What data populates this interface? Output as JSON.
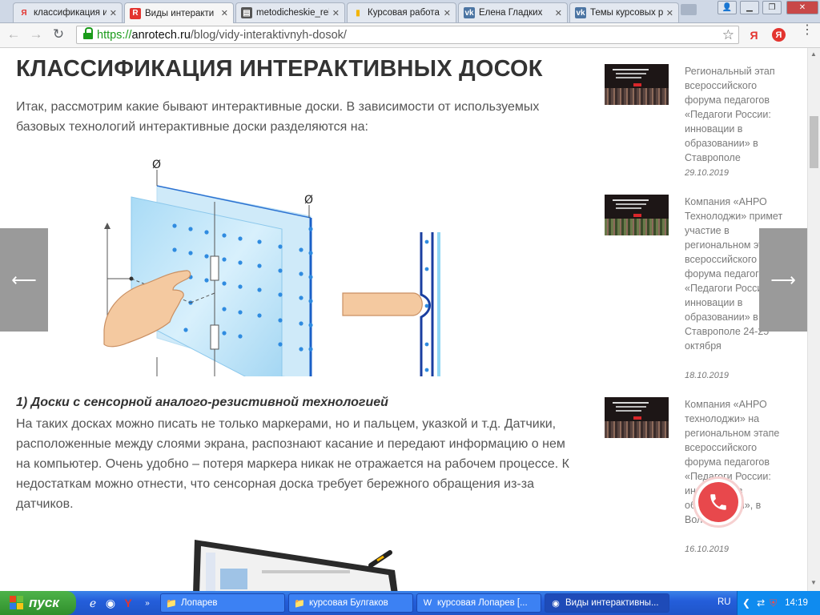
{
  "tabs": [
    {
      "label": "классификация и",
      "icon": "yandex-icon"
    },
    {
      "label": "Виды интеракти",
      "icon": "anrotech-icon"
    },
    {
      "label": "metodicheskie_rek",
      "icon": "document-icon"
    },
    {
      "label": "Курсовая работа",
      "icon": "google-docs-icon"
    },
    {
      "label": "Елена Гладких",
      "icon": "vk-icon"
    },
    {
      "label": "Темы курсовых р",
      "icon": "vk-icon"
    }
  ],
  "toolbar": {
    "url_scheme": "https://",
    "url_domain": "anrotech.ru",
    "url_path": "/blog/vidy-interaktivnyh-dosok/",
    "yandex_ext_label": "Я",
    "yandex_ext2_label": "Я"
  },
  "article": {
    "title": "КЛАССИФИКАЦИЯ ИНТЕРАКТИВНЫХ ДОСОК",
    "intro": "Итак, рассмотрим какие бывают интерактивные доски. В зависимости от используемых базовых технологий интерактивные доски разделяются на:",
    "section1_heading": "1) Доски с сенсорной аналого-резистивной технологией",
    "section1_text": "На таких досках можно писать не только маркерами, но и пальцем, указкой и т.д. Датчики, расположенные между слоями экрана, распознают касание и передают информацию о нем на компьютер. Очень удобно – потеря маркера никак не отражается на рабочем процессе. К недостаткам можно отнести, что сенсорная доска требует бережного обращения из-за датчиков.",
    "diagram_symbol_top": "Ø",
    "diagram_symbol_right": "Ø"
  },
  "sidebar": [
    {
      "title": "Региональный этап всероссийского форума педагогов «Педагоги России: инновации в образовании» в Ставрополе",
      "date": "29.10.2019"
    },
    {
      "title": "Компания «АНРО Технолоджи» примет участие в региональном этапе всероссийского форума педагогов «Педагоги России: инновации в образовании» в Ставрополе 24-25 октября",
      "date": "18.10.2019"
    },
    {
      "title": "Компания «АНРО технолоджи» на региональном этапе всероссийского форума педагогов «Педагоги России: инновации в образовании», в Вологде",
      "date": "16.10.2019"
    }
  ],
  "taskbar": {
    "start_label": "пуск",
    "tasks": [
      {
        "label": "Лопарев",
        "icon": "folder-icon"
      },
      {
        "label": "курсовая Булгаков",
        "icon": "folder-icon"
      },
      {
        "label": "курсовая Лопарев [...",
        "icon": "word-icon"
      },
      {
        "label": "Виды интерактивны...",
        "icon": "chrome-icon"
      }
    ],
    "language": "RU",
    "clock": "14:19"
  },
  "colors": {
    "accent_red": "#e8484c",
    "omnibox_green": "#1a9b1a",
    "taskbar_blue": "#245edb",
    "start_green": "#3a9d36"
  }
}
